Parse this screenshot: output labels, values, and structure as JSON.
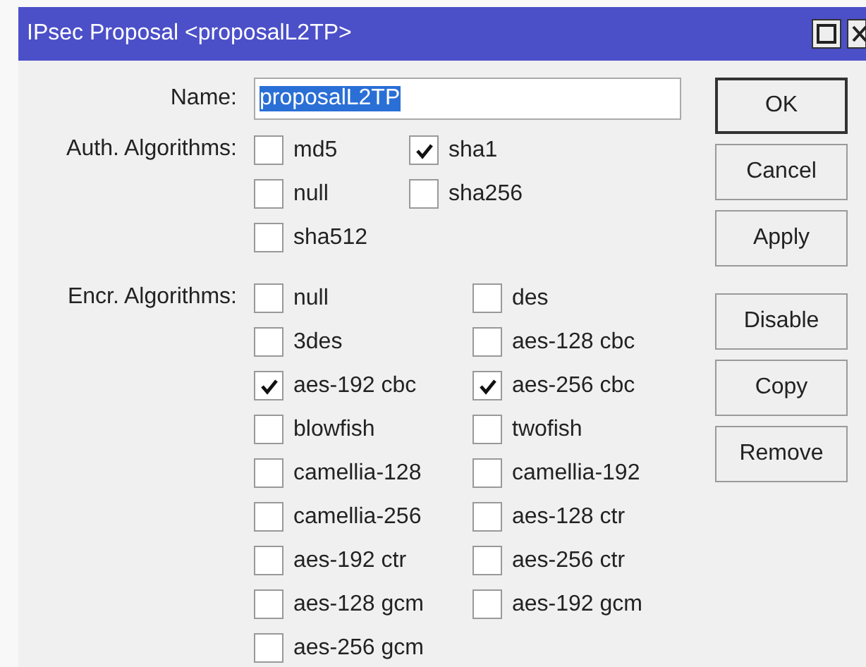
{
  "window": {
    "title": "IPsec Proposal <proposalL2TP>"
  },
  "name": {
    "label": "Name:",
    "value": "proposalL2TP",
    "selected": true
  },
  "auth": {
    "label": "Auth. Algorithms:",
    "items": [
      {
        "label": "md5",
        "checked": false
      },
      {
        "label": "sha1",
        "checked": true
      },
      {
        "label": "null",
        "checked": false
      },
      {
        "label": "sha256",
        "checked": false
      },
      {
        "label": "sha512",
        "checked": false
      }
    ]
  },
  "encr": {
    "label": "Encr. Algorithms:",
    "items": [
      {
        "label": "null",
        "checked": false
      },
      {
        "label": "des",
        "checked": false
      },
      {
        "label": "3des",
        "checked": false
      },
      {
        "label": "aes-128 cbc",
        "checked": false
      },
      {
        "label": "aes-192 cbc",
        "checked": true
      },
      {
        "label": "aes-256 cbc",
        "checked": true
      },
      {
        "label": "blowfish",
        "checked": false
      },
      {
        "label": "twofish",
        "checked": false
      },
      {
        "label": "camellia-128",
        "checked": false
      },
      {
        "label": "camellia-192",
        "checked": false
      },
      {
        "label": "camellia-256",
        "checked": false
      },
      {
        "label": "aes-128 ctr",
        "checked": false
      },
      {
        "label": "aes-192 ctr",
        "checked": false
      },
      {
        "label": "aes-256 ctr",
        "checked": false
      },
      {
        "label": "aes-128 gcm",
        "checked": false
      },
      {
        "label": "aes-192 gcm",
        "checked": false
      },
      {
        "label": "aes-256 gcm",
        "checked": false
      }
    ]
  },
  "buttons": [
    {
      "label": "OK",
      "kind": "default"
    },
    {
      "label": "Cancel",
      "kind": "normal"
    },
    {
      "label": "Apply",
      "kind": "normal"
    },
    {
      "label": "Disable",
      "kind": "gap"
    },
    {
      "label": "Copy",
      "kind": "normal"
    },
    {
      "label": "Remove",
      "kind": "normal"
    }
  ]
}
